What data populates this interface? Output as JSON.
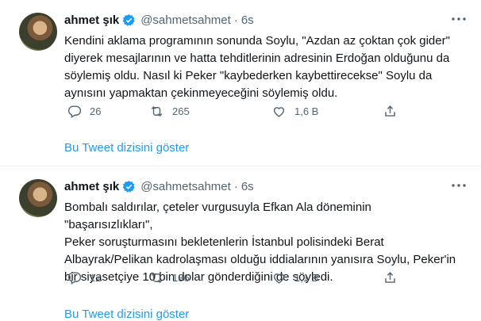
{
  "tweets": [
    {
      "name": "ahmet şık",
      "handle": "@sahmetsahmet",
      "separator": "·",
      "time": "6s",
      "text": "Kendini aklama programının sonunda Soylu, \"Azdan az çoktan çok gider\"\ndiyerek mesajlarının ve hatta tehditlerinin adresinin Erdoğan olduğunu da\nsöylemiş oldu. Nasıl ki Peker \"kaybederken kaybettirecekse\" Soylu da\naynısını yapmaktan çekinmeyeceğini söylemiş oldu.",
      "replies": "26",
      "retweets": "265",
      "likes": "1,6 B",
      "show_thread": "Bu Tweet dizisini göster"
    },
    {
      "name": "ahmet şık",
      "handle": "@sahmetsahmet",
      "separator": "·",
      "time": "6s",
      "text": "Bombalı saldırılar, çeteler vurgusuyla Efkan Ala döneminin \"başarısızlıkları\",\nPeker soruşturmasını bekletenlerin İstanbul polisindeki Berat\nAlbayrak/Pelikan kadrolaşması olduğu iddialarının yanısıra Soylu, Peker'in\nbir siyasetçiye 10 bin dolar gönderdiğini de söyledi.",
      "replies": "12",
      "retweets": "136",
      "likes": "1,1 B",
      "show_thread": "Bu Tweet dizisini göster"
    }
  ],
  "colors": {
    "accent": "#1d9bf0",
    "secondary_text": "#536471",
    "text": "#0f1419",
    "divider": "#eff3f4"
  },
  "icons": [
    "verified-badge-icon",
    "more-icon",
    "reply-icon",
    "retweet-icon",
    "like-icon",
    "share-icon"
  ]
}
